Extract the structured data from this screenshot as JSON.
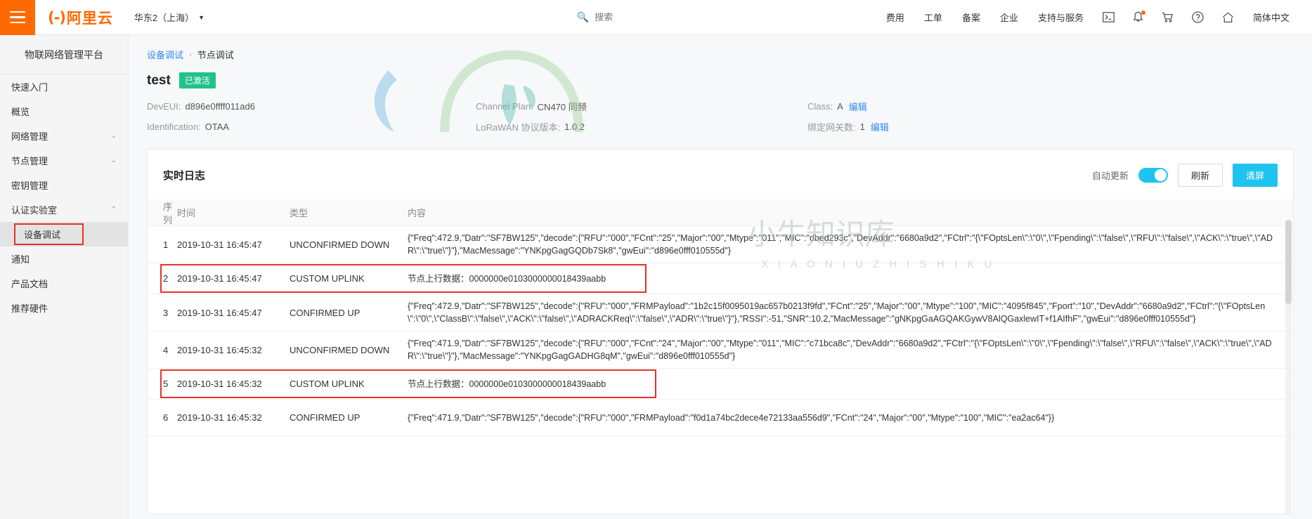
{
  "topbar": {
    "menu_icon": "hamburger-icon",
    "brand_mark": "(-)",
    "brand_text": "阿里云",
    "region": "华东2（上海）",
    "region_caret": "▼",
    "search_icon": "search-icon",
    "search_placeholder": "搜索",
    "search_value": "",
    "links": [
      "费用",
      "工单",
      "备案",
      "企业",
      "支持与服务"
    ],
    "icons": [
      "console-icon",
      "bell-icon",
      "cart-icon",
      "help-icon",
      "home-icon"
    ],
    "language": "简体中文"
  },
  "sidebar": {
    "title": "物联网络管理平台",
    "items": [
      {
        "label": "快速入门",
        "expandable": false
      },
      {
        "label": "概览",
        "expandable": false
      },
      {
        "label": "网络管理",
        "expandable": true,
        "arrow": "⌄"
      },
      {
        "label": "节点管理",
        "expandable": true,
        "arrow": "⌄"
      },
      {
        "label": "密钥管理",
        "expandable": false
      },
      {
        "label": "认证实验室",
        "expandable": true,
        "arrow": "⌃"
      }
    ],
    "sub_item": "设备调试",
    "after_items": [
      {
        "label": "通知"
      },
      {
        "label": "产品文档"
      },
      {
        "label": "推荐硬件"
      }
    ]
  },
  "breadcrumb": {
    "parent": "设备调试",
    "separator": "›",
    "current": "节点调试"
  },
  "device": {
    "name": "test",
    "status_badge": "已激活",
    "fields": [
      {
        "label": "DevEUI:",
        "value": "d896e0ffff011ad6",
        "edit": ""
      },
      {
        "label": "Channel Plan:",
        "value": "CN470 同频",
        "edit": ""
      },
      {
        "label": "Class:",
        "value": "A",
        "edit": "编辑"
      },
      {
        "label": "Identification:",
        "value": "OTAA",
        "edit": ""
      },
      {
        "label": "LoRaWAN 协议版本:",
        "value": "1.0.2",
        "edit": ""
      },
      {
        "label": "绑定网关数:",
        "value": "1",
        "edit": "编辑"
      }
    ]
  },
  "log_panel": {
    "title": "实时日志",
    "auto_update_label": "自动更新",
    "auto_update_on": true,
    "refresh_button": "刷新",
    "clear_button": "清屏",
    "columns": [
      "序列",
      "时间",
      "类型",
      "内容"
    ],
    "rows": [
      {
        "seq": "1",
        "time": "2019-10-31 16:45:47",
        "type": "UNCONFIRMED DOWN",
        "content": "{\"Freq\":472.9,\"Datr\":\"SF7BW125\",\"decode\":{\"RFU\":\"000\",\"FCnt\":\"25\",\"Major\":\"00\",\"Mtype\":\"011\",\"MIC\":\"dbed293c\",\"DevAddr\":\"6680a9d2\",\"FCtrl\":\"{\\\"FOptsLen\\\":\\\"0\\\",\\\"Fpending\\\":\\\"false\\\",\\\"RFU\\\":\\\"false\\\",\\\"ACK\\\":\\\"true\\\",\\\"ADR\\\":\\\"true\\\"}\"},\"MacMessage\":\"YNKpgGagGQDb7Sk8\",\"gwEui\":\"d896e0fff010555d\"}",
        "highlight": false
      },
      {
        "seq": "2",
        "time": "2019-10-31 16:45:47",
        "type": "CUSTOM UPLINK",
        "content": "节点上行数据：0000000e0103000000018439aabb",
        "highlight": true,
        "highlight_width": "w1"
      },
      {
        "seq": "3",
        "time": "2019-10-31 16:45:47",
        "type": "CONFIRMED UP",
        "content": "{\"Freq\":472.9,\"Datr\":\"SF7BW125\",\"decode\":{\"RFU\":\"000\",\"FRMPayload\":\"1b2c15f0095019ac657b0213f9fd\",\"FCnt\":\"25\",\"Major\":\"00\",\"Mtype\":\"100\",\"MIC\":\"4095f845\",\"Fport\":\"10\",\"DevAddr\":\"6680a9d2\",\"FCtrl\":\"{\\\"FOptsLen\\\":\\\"0\\\",\\\"ClassB\\\":\\\"false\\\",\\\"ACK\\\":\\\"false\\\",\\\"ADRACKReq\\\":\\\"false\\\",\\\"ADR\\\":\\\"true\\\"}\"},\"RSSI\":-51,\"SNR\":10.2,\"MacMessage\":\"gNKpgGaAGQAKGywV8AlQGaxlewIT+f1AIfhF\",\"gwEui\":\"d896e0fff010555d\"}",
        "highlight": false
      },
      {
        "seq": "4",
        "time": "2019-10-31 16:45:32",
        "type": "UNCONFIRMED DOWN",
        "content": "{\"Freq\":471.9,\"Datr\":\"SF7BW125\",\"decode\":{\"RFU\":\"000\",\"FCnt\":\"24\",\"Major\":\"00\",\"Mtype\":\"011\",\"MIC\":\"c71bca8c\",\"DevAddr\":\"6680a9d2\",\"FCtrl\":\"{\\\"FOptsLen\\\":\\\"0\\\",\\\"Fpending\\\":\\\"false\\\",\\\"RFU\\\":\\\"false\\\",\\\"ACK\\\":\\\"true\\\",\\\"ADR\\\":\\\"true\\\"}\"},\"MacMessage\":\"YNKpgGagGADHG8qM\",\"gwEui\":\"d896e0fff010555d\"}",
        "highlight": false
      },
      {
        "seq": "5",
        "time": "2019-10-31 16:45:32",
        "type": "CUSTOM UPLINK",
        "content": "节点上行数据：0000000e0103000000018439aabb",
        "highlight": true,
        "highlight_width": "w2"
      },
      {
        "seq": "6",
        "time": "2019-10-31 16:45:32",
        "type": "CONFIRMED UP",
        "content": "{\"Freq\":471.9,\"Datr\":\"SF7BW125\",\"decode\":{\"RFU\":\"000\",\"FRMPayload\":\"f0d1a74bc2dece4e72133aa556d9\",\"FCnt\":\"24\",\"Major\":\"00\",\"Mtype\":\"100\",\"MIC\":\"ea2ac64\"}}",
        "highlight": false
      }
    ]
  },
  "watermark": {
    "text": "小牛知识库",
    "subtext": "X I A O N I U Z H I S H I K U"
  }
}
